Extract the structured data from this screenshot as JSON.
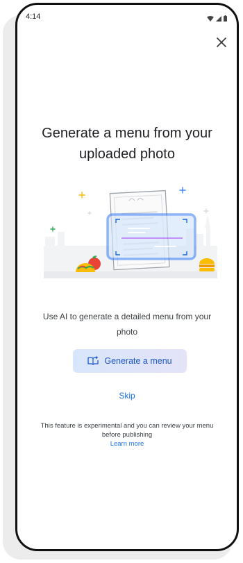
{
  "status_bar": {
    "time": "4:14"
  },
  "dialog": {
    "title": "Generate a menu from your uploaded photo",
    "description": "Use AI to generate a detailed menu from your photo",
    "generate_label": "Generate a menu",
    "skip_label": "Skip",
    "note": "This feature is experimental and you can review your menu before publishing",
    "learn_more": "Learn more"
  },
  "icons": {
    "close": "close-icon",
    "generate": "sparkle-menu-icon",
    "wifi": "wifi-icon",
    "signal": "signal-icon",
    "battery": "battery-icon"
  },
  "colors": {
    "accent": "#1a73e8",
    "button_bg": "#dde8fb",
    "text": "#202124"
  }
}
